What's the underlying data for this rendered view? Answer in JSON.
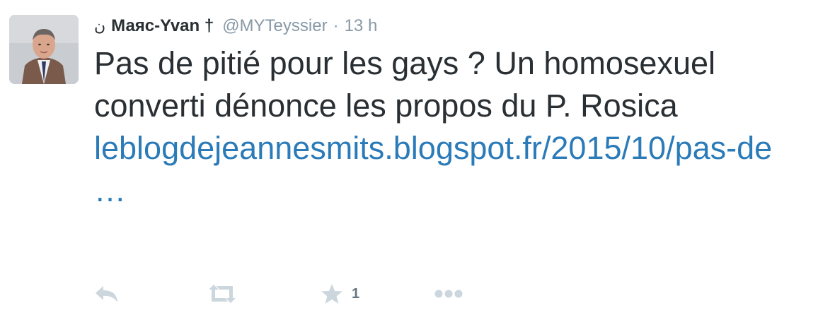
{
  "tweet": {
    "author": {
      "prefix_glyph": "ن",
      "name": "Маяс-Yvan †",
      "handle": "@MYTeyssier",
      "separator": "·",
      "time": "13 h",
      "avatar_icon": "profile-photo"
    },
    "text": "Pas de pitié pour les gays ? Un homosexuel converti dénonce les propos du P. Rosica",
    "link": "leblogdejeannesmits.blogspot.fr/2015/10/pas-de  …",
    "actions": {
      "reply_icon": "reply-icon",
      "retweet_icon": "retweet-icon",
      "favorite_icon": "star-icon",
      "favorite_count": "1",
      "more_icon": "more-icon"
    }
  },
  "colors": {
    "text": "#292f33",
    "muted": "#8899a6",
    "link": "#2b7bb9",
    "action_icon": "#ccd6dd",
    "favorite_active": "#66757f"
  }
}
